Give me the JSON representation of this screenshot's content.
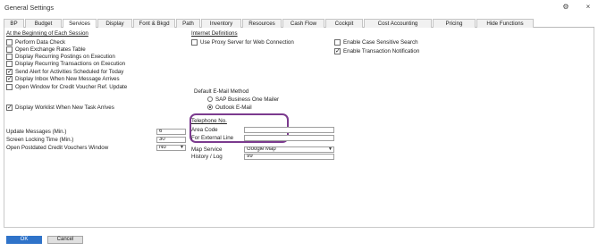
{
  "window": {
    "title": "General Settings",
    "close_glyph": "×"
  },
  "tabs": [
    {
      "label": "BP",
      "active": false
    },
    {
      "label": "Budget",
      "active": false
    },
    {
      "label": "Services",
      "active": true
    },
    {
      "label": "Display",
      "active": false
    },
    {
      "label": "Font & Bkgd",
      "active": false
    },
    {
      "label": "Path",
      "active": false
    },
    {
      "label": "Inventory",
      "active": false
    },
    {
      "label": "Resources",
      "active": false
    },
    {
      "label": "Cash Flow",
      "active": false
    },
    {
      "label": "Cockpit",
      "active": false
    },
    {
      "label": "Cost Accounting",
      "active": false
    },
    {
      "label": "Pricing",
      "active": false
    },
    {
      "label": "Hide Functions",
      "active": false
    }
  ],
  "session": {
    "heading": "At the Beginning of Each Session",
    "items": [
      {
        "label": "Perform Data Check",
        "checked": false
      },
      {
        "label": "Open Exchange Rates Table",
        "checked": false
      },
      {
        "label": "Display Recurring Postings on Execution",
        "checked": false
      },
      {
        "label": "Display Recurring Transactions on Execution",
        "checked": false
      },
      {
        "label": "Send Alert for Activities Scheduled for Today",
        "checked": true
      },
      {
        "label": "Display Inbox When New Message Arrives",
        "checked": true
      },
      {
        "label": "Open Window for Credit Voucher Ref. Update",
        "checked": false
      }
    ],
    "worklist": {
      "label": "Display Worklist When New Task Arrives",
      "checked": true
    }
  },
  "internet": {
    "heading": "Internet Definitions",
    "proxy": {
      "label": "Use Proxy Server for Web Connection",
      "checked": false
    }
  },
  "right_options": [
    {
      "label": "Enable Case Sensitive Search",
      "checked": false
    },
    {
      "label": "Enable Transaction Notification",
      "checked": true
    }
  ],
  "email": {
    "heading": "Default E-Mail Method",
    "options": [
      {
        "label": "SAP Business One Mailer",
        "selected": false
      },
      {
        "label": "Outlook E-Mail",
        "selected": true
      }
    ]
  },
  "messages": {
    "update_label": "Update Messages (Min.)",
    "update_value": "6",
    "lock_label": "Screen Locking Time (Min.)",
    "lock_value": "30",
    "postdated_label": "Open Postdated Credit Vouchers Window",
    "postdated_value": "No"
  },
  "telephone": {
    "heading": "Telephone No.",
    "area_code_label": "Area Code",
    "area_code_value": "",
    "external_line_label": "For External Line",
    "external_line_value": "",
    "map_service_label": "Map Service",
    "map_service_value": "Google Map",
    "history_label": "History / Log",
    "history_value": "99"
  },
  "buttons": {
    "ok": "OK",
    "cancel": "Cancel"
  },
  "colors": {
    "accent_blue": "#2f73c9",
    "highlight_purple": "#7b3a8e"
  }
}
